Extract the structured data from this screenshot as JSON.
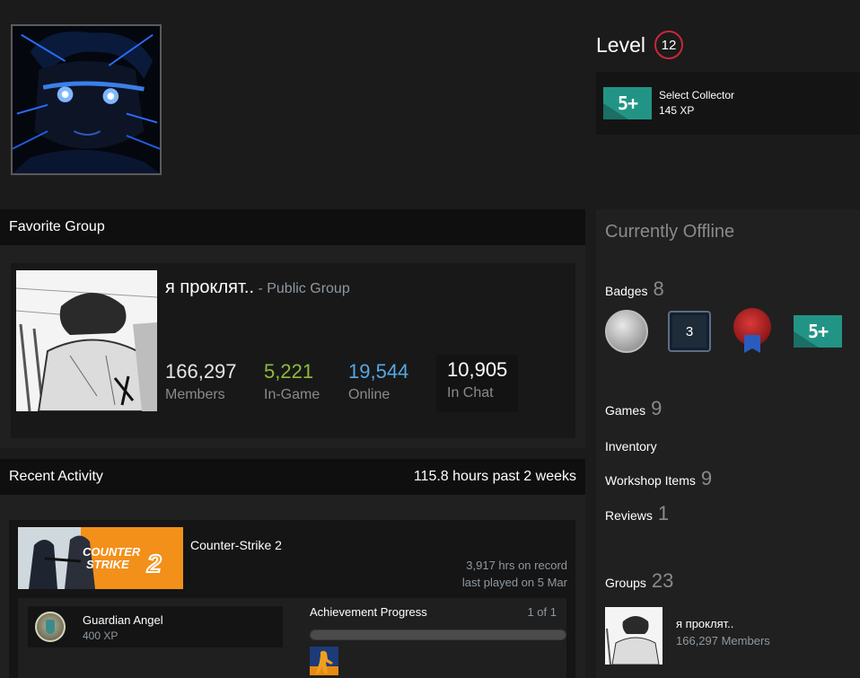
{
  "profile": {
    "level_label": "Level",
    "level": "12",
    "featured_badge": {
      "icon": "5plus-badge-icon",
      "name": "Select Collector",
      "xp": "145 XP"
    }
  },
  "favorite_group": {
    "header": "Favorite Group",
    "name": "я проклят..",
    "type": " - Public Group",
    "stats": [
      {
        "value": "166,297",
        "label": "Members"
      },
      {
        "value": "5,221",
        "label": "In-Game"
      },
      {
        "value": "19,544",
        "label": "Online"
      },
      {
        "value": "10,905",
        "label": "In Chat"
      }
    ]
  },
  "recent_activity": {
    "header": "Recent Activity",
    "summary": "115.8 hours past 2 weeks",
    "game": {
      "name": "Counter-Strike 2",
      "hours": "3,917 hrs on record",
      "last_played": "last played on 5 Mar",
      "achievement": {
        "name": "Guardian Angel",
        "xp": "400 XP"
      },
      "progress_label": "Achievement Progress",
      "progress_count": "1 of 1",
      "progress_fraction": 1.0
    }
  },
  "sidebar": {
    "status": "Currently Offline",
    "badges_label": "Badges",
    "badges_count": "8",
    "badge_box_value": "3",
    "games_label": "Games",
    "games_count": "9",
    "inventory_label": "Inventory",
    "workshop_label": "Workshop Items",
    "workshop_count": "9",
    "reviews_label": "Reviews",
    "reviews_count": "1",
    "groups_label": "Groups",
    "groups_count": "23",
    "group": {
      "name": "я проклят..",
      "members": "166,297 Members"
    }
  },
  "colors": {
    "level_ring": "#c9273a",
    "in_game": "#90ba3c",
    "online": "#57a7e4",
    "badge_teal": "#229485"
  }
}
